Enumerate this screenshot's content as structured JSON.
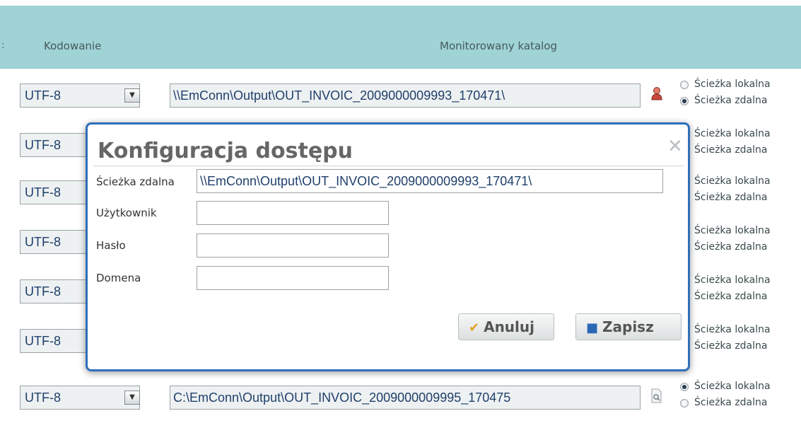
{
  "header": {
    "sep": ":",
    "encoding_col": "Kodowanie",
    "monitored_col": "Monitorowany katalog"
  },
  "encoding_value": "UTF-8",
  "rows": [
    {
      "path": "\\\\EmConn\\Output\\OUT_INVOIC_2009000009993_170471\\",
      "icon": "user-icon",
      "local": "Ścieżka lokalna",
      "remote": "Ścieżka zdalna",
      "selected": "remote"
    },
    {
      "local": "Ścieżka lokalna",
      "remote": "Ścieżka zdalna"
    },
    {
      "local": "Ścieżka lokalna",
      "remote": "Ścieżka zdalna"
    },
    {
      "local": "Ścieżka lokalna",
      "remote": "Ścieżka zdalna"
    },
    {
      "local": "Ścieżka lokalna",
      "remote": "Ścieżka zdalna"
    },
    {
      "local": "Ścieżka lokalna",
      "remote": "Ścieżka zdalna"
    },
    {
      "path": "C:\\EmConn\\Output\\OUT_INVOIC_2009000009995_170475",
      "icon": "browse-icon",
      "local": "Ścieżka lokalna",
      "remote": "Ścieżka zdalna",
      "selected": "local"
    }
  ],
  "dialog": {
    "title": "Konfiguracja dostępu",
    "close": "✕",
    "fields": {
      "remote_label": "Ścieżka zdalna",
      "remote_value": "\\\\EmConn\\Output\\OUT_INVOIC_2009000009993_170471\\",
      "user_label": "Użytkownik",
      "password_label": "Hasło",
      "domain_label": "Domena"
    },
    "cancel_label": "Anuluj",
    "save_label": "Zapisz"
  }
}
